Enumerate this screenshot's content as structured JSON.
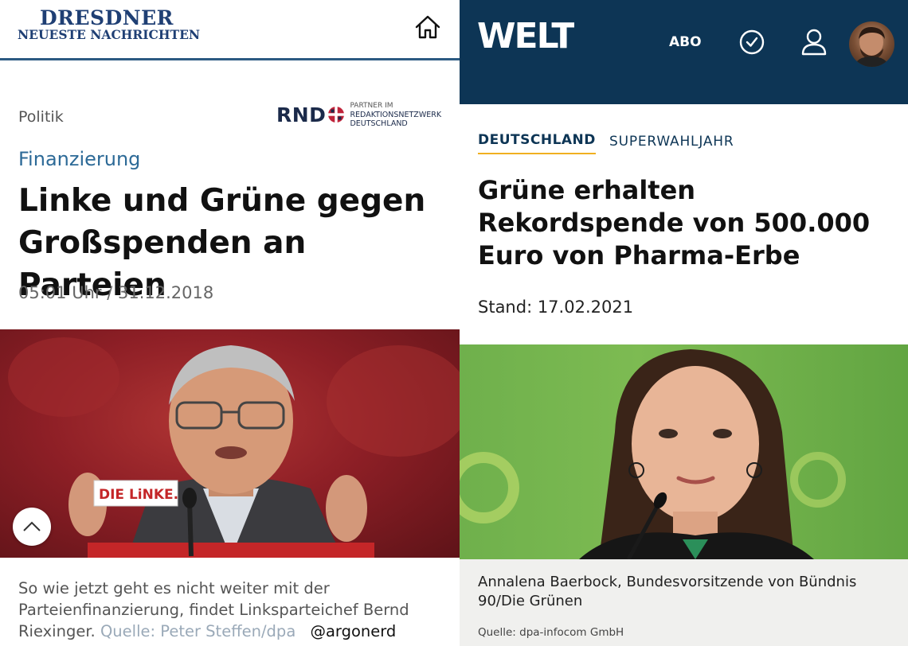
{
  "left_panel": {
    "logo": {
      "line1": "DRESDNER",
      "line2": "NEUESTE NACHRICHTEN"
    },
    "section": "Politik",
    "partner": {
      "brand": "RND",
      "label_small": "PARTNER IM",
      "label_line1": "REDAKTIONSNETZWERK",
      "label_line2": "DEUTSCHLAND"
    },
    "kicker": "Finanzierung",
    "headline": "Linke und Grüne gegen Großspenden an Parteien",
    "timestamp": "05:01 Uhr",
    "separator": "/",
    "date": "31.12.2018",
    "photo_sign": "DIE LiNKE.",
    "caption": "So wie jetzt geht es nicht weiter mit der Parteienfinanzierung, findet Linksparteichef Bernd Riexinger.",
    "caption_source": "Quelle: Peter Steffen/dpa",
    "handle": "@argonerd",
    "icons": {
      "home": "home-icon",
      "scroll_top": "chevron-up-icon"
    }
  },
  "right_panel": {
    "logo": "WELT",
    "abo_label": "ABO",
    "icons": {
      "clock": "clock-icon",
      "user": "user-icon",
      "avatar": "avatar"
    },
    "tabs": [
      {
        "label": "DEUTSCHLAND",
        "active": true
      },
      {
        "label": "SUPERWAHLJAHR",
        "active": false
      }
    ],
    "headline": "Grüne erhalten Rekordspende von 500.000 Euro von Pharma-Erbe",
    "date": "Stand: 17.02.2021",
    "caption": "Annalena Baerbock, Bundesvorsitzende von Bündnis 90/Die Grünen",
    "caption_source": "Quelle: dpa-infocom GmbH"
  },
  "colors": {
    "dnn_blue": "#1f3f74",
    "dnn_rule": "#2c5a82",
    "dnn_kicker": "#2d6a97",
    "welt_navy": "#0d3555",
    "welt_accent": "#f0b020",
    "linke_red": "#8e1f26",
    "gruene_green": "#6fb04c"
  }
}
